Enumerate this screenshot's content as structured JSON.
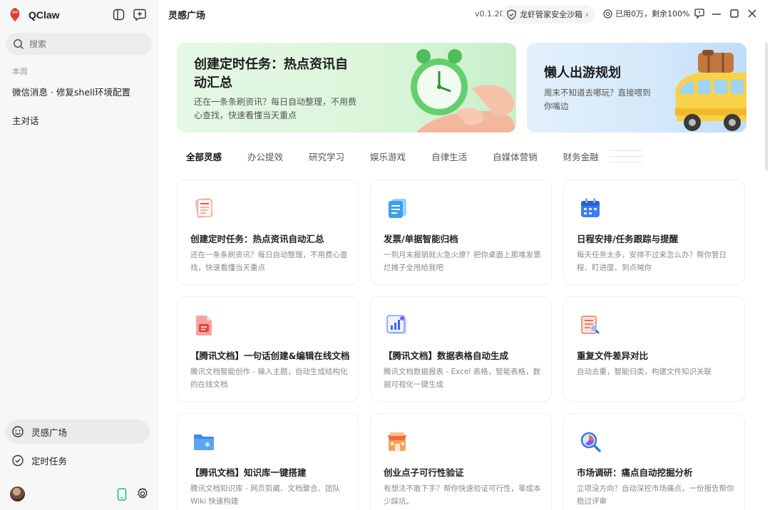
{
  "app": {
    "name": "QClaw"
  },
  "sidebar": {
    "search_placeholder": "搜索",
    "section_label": "本周",
    "conversations": [
      "微信消息 · 修复shell环境配置",
      "主对话"
    ],
    "nav": [
      {
        "label": "灵感广场",
        "icon": "inspiration-icon",
        "active": true
      },
      {
        "label": "定时任务",
        "icon": "check-clock-icon",
        "active": false
      }
    ]
  },
  "header": {
    "title": "灵感广场",
    "version": "v0.1.20",
    "sandbox_label": "龙虾管家安全沙箱",
    "quota_label": "已用0万，剩余100%"
  },
  "banners": [
    {
      "title": "创建定时任务：热点资讯自动汇总",
      "desc": "还在一条条刷资讯？每日自动整理，不用费心查找，快速看懂当天重点",
      "color": "#daf5da"
    },
    {
      "title": "懒人出游规划",
      "desc": "周末不知道去哪玩？直接喂到你嘴边",
      "color": "#d4e8fa"
    }
  ],
  "tabs": [
    "全部灵感",
    "办公提效",
    "研究学习",
    "娱乐游戏",
    "自律生活",
    "自媒体营销",
    "财务金融"
  ],
  "cards": [
    {
      "title": "创建定时任务：热点资讯自动汇总",
      "desc": "还在一条条刷资讯？每日自动整理，不用费心查找，快速看懂当天重点",
      "icon": "news-paper-icon"
    },
    {
      "title": "发票/单据智能归档",
      "desc": "一到月末报销就火急火燎？把你桌面上那堆发票烂摊子全甩给我吧",
      "icon": "invoice-icon"
    },
    {
      "title": "日程安排/任务跟踪与提醒",
      "desc": "每天任务太多，安排不过来怎么办？帮你管日程、盯进度、到点喊你",
      "icon": "calendar-icon"
    },
    {
      "title": "【腾讯文档】一句话创建&编辑在线文档",
      "desc": "腾讯文档智能创作 - 输入主题，自动生成结构化的在线文档",
      "icon": "document-icon"
    },
    {
      "title": "【腾讯文档】数据表格自动生成",
      "desc": "腾讯文档数据报表 - Excel 表格，智能表格，数据可视化一键生成",
      "icon": "spreadsheet-icon"
    },
    {
      "title": "重复文件差异对比",
      "desc": "自动去重，智能归类，构建文件知识关联",
      "icon": "compare-file-icon"
    },
    {
      "title": "【腾讯文档】知识库一键搭建",
      "desc": "腾讯文档知识库 - 网页剪藏、文档聚合、团队 Wiki 快速构建",
      "icon": "folder-icon"
    },
    {
      "title": "创业点子可行性验证",
      "desc": "有想法不敢下手？帮你快速验证可行性，零成本少踩坑。",
      "icon": "shop-icon"
    },
    {
      "title": "市场调研：痛点自动挖掘分析",
      "desc": "立项没方向？自动深挖市场痛点，一份报告帮你稳过评审",
      "icon": "magnifier-chart-icon"
    }
  ]
}
